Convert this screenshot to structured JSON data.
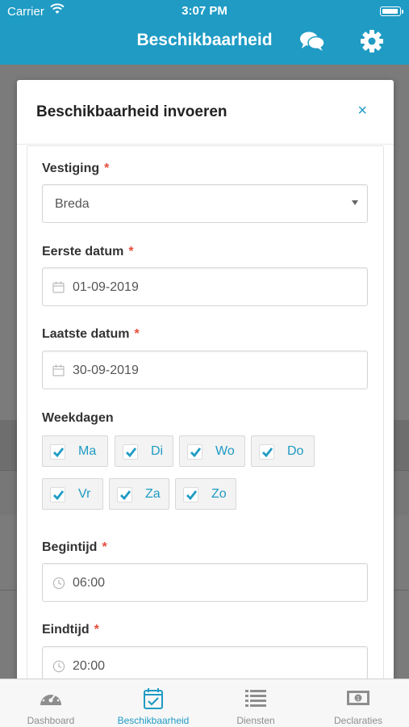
{
  "status_bar": {
    "carrier": "Carrier",
    "time": "3:07 PM"
  },
  "header": {
    "title": "Beschikbaarheid"
  },
  "modal": {
    "title": "Beschikbaarheid invoeren",
    "close": "×",
    "fields": {
      "vestiging": {
        "label": "Vestiging",
        "required": "*",
        "value": "Breda"
      },
      "eerste_datum": {
        "label": "Eerste datum",
        "required": "*",
        "value": "01-09-2019"
      },
      "laatste_datum": {
        "label": "Laatste datum",
        "required": "*",
        "value": "30-09-2019"
      },
      "weekdagen": {
        "label": "Weekdagen",
        "days": [
          {
            "label": "Ma",
            "checked": true
          },
          {
            "label": "Di",
            "checked": true
          },
          {
            "label": "Wo",
            "checked": true
          },
          {
            "label": "Do",
            "checked": true
          },
          {
            "label": "Vr",
            "checked": true
          },
          {
            "label": "Za",
            "checked": true
          },
          {
            "label": "Zo",
            "checked": true
          }
        ]
      },
      "begintijd": {
        "label": "Begintijd",
        "required": "*",
        "value": "06:00"
      },
      "eindtijd": {
        "label": "Eindtijd",
        "required": "*",
        "value": "20:00"
      }
    }
  },
  "tabbar": {
    "tabs": [
      {
        "label": "Dashboard",
        "icon": "dashboard-icon",
        "active": false
      },
      {
        "label": "Beschikbaarheid",
        "icon": "calendar-check-icon",
        "active": true
      },
      {
        "label": "Diensten",
        "icon": "list-icon",
        "active": false
      },
      {
        "label": "Declaraties",
        "icon": "money-icon",
        "active": false
      }
    ]
  },
  "colors": {
    "accent": "#1f9bc4",
    "required": "#e74c3c",
    "tab_inactive": "#8e8e8e"
  }
}
